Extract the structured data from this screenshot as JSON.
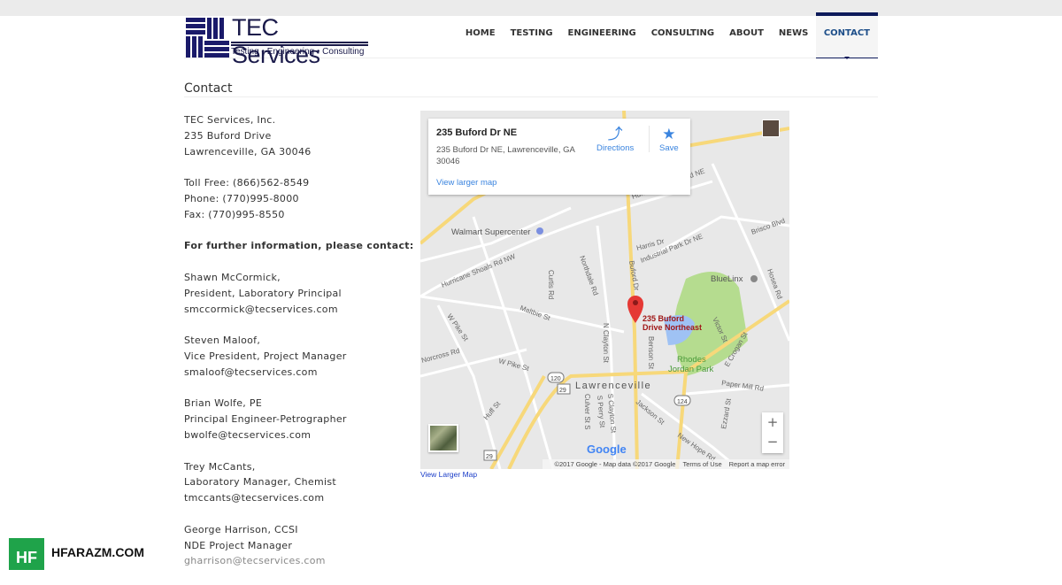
{
  "logo": {
    "title": "TEC Services",
    "tagline": "Testing • Engineering • Consulting"
  },
  "nav": [
    "HOME",
    "TESTING",
    "ENGINEERING",
    "CONSULTING",
    "ABOUT",
    "NEWS",
    "CONTACT"
  ],
  "nav_active": "CONTACT",
  "page_title": "Contact",
  "address": [
    "TEC Services, Inc.",
    "235 Buford Drive",
    "Lawrenceville, GA 30046"
  ],
  "phones": [
    "Toll Free: (866)562-8549",
    "Phone: (770)995-8000",
    "Fax: (770)995-8550"
  ],
  "contact_heading": "For further information, please contact:",
  "contacts": [
    {
      "name": "Shawn McCormick,",
      "title": "President, Laboratory Principal",
      "email": "smccormick@tecservices.com"
    },
    {
      "name": "Steven Maloof,",
      "title": "Vice President, Project Manager",
      "email": "smaloof@tecservices.com"
    },
    {
      "name": "Brian Wolfe, PE",
      "title": "Principal Engineer-Petrographer",
      "email": "bwolfe@tecservices.com"
    },
    {
      "name": "Trey McCants,",
      "title": "Laboratory Manager, Chemist",
      "email": "tmccants@tecservices.com"
    },
    {
      "name": "George Harrison, CCSI",
      "title": "NDE Project Manager",
      "email": "gharrison@tecservices.com"
    }
  ],
  "map": {
    "card_title": "235 Buford Dr NE",
    "card_address": "235 Buford Dr NE, Lawrenceville, GA 30046",
    "view_larger": "View larger map",
    "directions": "Directions",
    "save": "Save",
    "pin_label": [
      "235 Buford",
      "Drive Northeast"
    ],
    "labels": {
      "walmart": "Walmart Supercenter",
      "bluelinx": "BlueLinx",
      "park1": "Rhodes",
      "park2": "Jordan Park",
      "city": "Lawrenceville",
      "buford": "Buford Dr",
      "hurricane": "Hurricane Shoals Rd NW",
      "hurricane_ne": "Hurricane Shoals Rd NE",
      "harris": "Harris Dr",
      "industrial": "Industrial Park Dr NE",
      "brisco": "Brisco Blvd",
      "hosea": "Hosea Rd",
      "northdale": "Northdale Rd",
      "curtis": "Curtis Rd",
      "maltbie": "Maltbie St",
      "wpike": "W Pike St",
      "wpike2": "W Pike St",
      "norcross": "Norcross Rd",
      "nclayton": "N Clayton St",
      "benson": "Benson St",
      "victor": "Victor St",
      "crogan": "E Crogan St",
      "papermill": "Paper Mill Rd",
      "sperry": "S Perry St",
      "sclayton": "S Clayton St",
      "culver": "Culver St S",
      "jackson": "Jackson St",
      "huff": "Huff St",
      "ezzard": "Ezzard St",
      "newhope": "New Hope Rd",
      "r120": "120",
      "r29": "29",
      "r124": "124",
      "r29b": "29"
    },
    "google": "Google",
    "copyright": "©2017 Google - Map data ©2017 Google",
    "terms": "Terms of Use",
    "report": "Report a map error",
    "zoom_in": "+",
    "zoom_out": "−",
    "colors": {
      "road": "#f7d87a",
      "park": "#b5dc8f",
      "water": "#9fc2f4",
      "pin": "#e53935"
    }
  },
  "view_larger_map_link": "View Larger Map",
  "watermark": {
    "badge": "HF",
    "site": "HFARAZM.COM"
  }
}
